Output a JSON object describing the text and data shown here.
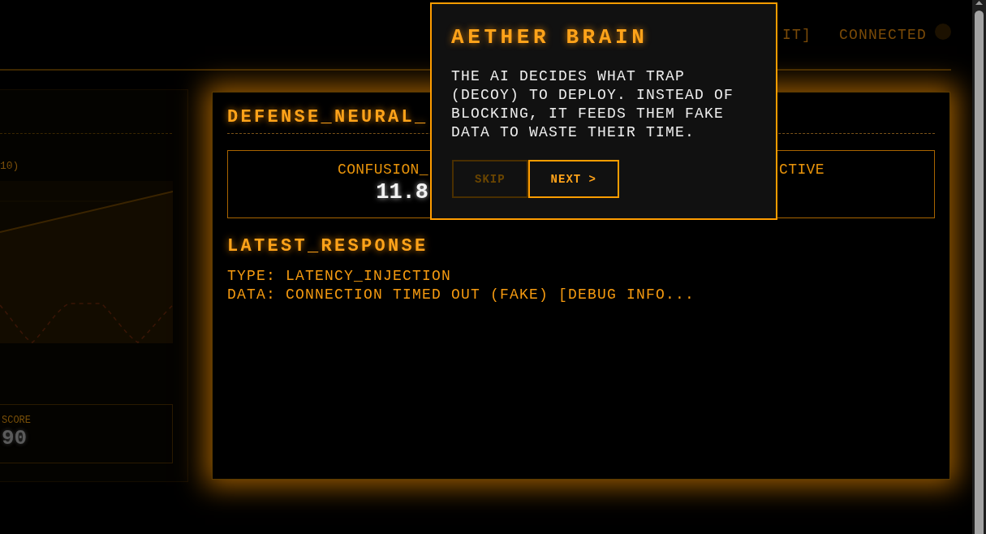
{
  "header": {
    "link": "IT]",
    "status": "CONNECTED"
  },
  "side_panel": {
    "caption": "10)",
    "score": {
      "label": "SCORE",
      "value": "90"
    }
  },
  "panel": {
    "title": "DEFENSE_NEURAL_",
    "stats": [
      {
        "label": "CONFUSION_",
        "value": "11.8"
      },
      {
        "label": "CTIVE"
      }
    ],
    "latest_response": {
      "title": "LATEST_RESPONSE",
      "lines": [
        "TYPE: LATENCY_INJECTION",
        "DATA: CONNECTION TIMED OUT (FAKE) [DEBUG INFO..."
      ]
    }
  },
  "tour_popup": {
    "title": "AETHER BRAIN",
    "text": "THE AI DECIDES WHAT TRAP (DECOY) TO DEPLOY. INSTEAD OF BLOCKING, IT FEEDS THEM FAKE DATA TO WASTE THEIR TIME.",
    "buttons": [
      {
        "label": "SKIP",
        "disabled": true
      },
      {
        "label": "NEXT >",
        "disabled": false
      }
    ]
  }
}
